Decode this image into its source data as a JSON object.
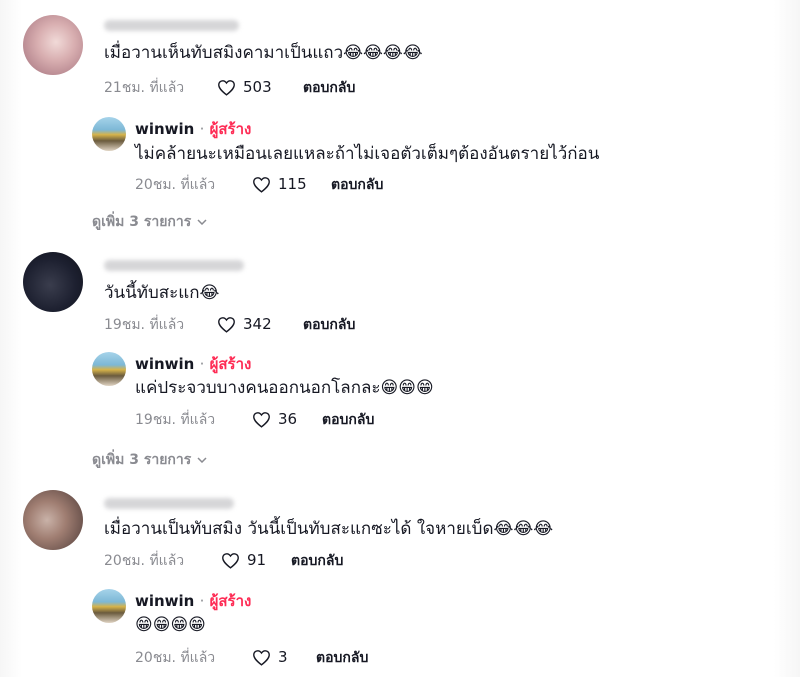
{
  "threads": [
    {
      "comment": {
        "text": "เมื่อวานเห็นทับสมิงคามาเป็นแถว",
        "emojis": "😂😂😂😂",
        "time": "21ชม. ที่แล้ว",
        "likes": "503",
        "reply_label": "ตอบกลับ"
      },
      "reply": {
        "user": "winwin",
        "separator": "·",
        "role": "ผู้สร้าง",
        "text": "ไม่คล้ายนะเหมือนเลยแหละถ้าไม่เจอตัวเต็มๆต้องอันตรายไว้ก่อน",
        "emojis": "",
        "time": "20ชม. ที่แล้ว",
        "likes": "115",
        "reply_label": "ตอบกลับ"
      },
      "more": "ดูเพิ่ม 3 รายการ"
    },
    {
      "comment": {
        "text": "วันนี้ทับสะแก",
        "emojis": "😂",
        "time": "19ชม. ที่แล้ว",
        "likes": "342",
        "reply_label": "ตอบกลับ"
      },
      "reply": {
        "user": "winwin",
        "separator": "·",
        "role": "ผู้สร้าง",
        "text": "แค่ประจวบบางคนออกนอกโลกละ",
        "emojis": "😁😁😁",
        "time": "19ชม. ที่แล้ว",
        "likes": "36",
        "reply_label": "ตอบกลับ"
      },
      "more": "ดูเพิ่ม 3 รายการ"
    },
    {
      "comment": {
        "text": "เมื่อวานเป็นทับสมิง วันนี้เป็นทับสะแกซะได้ ใจหายเบ็ด",
        "emojis": "😂😂😂",
        "time": "20ชม. ที่แล้ว",
        "likes": "91",
        "reply_label": "ตอบกลับ"
      },
      "reply": {
        "user": "winwin",
        "separator": "·",
        "role": "ผู้สร้าง",
        "text": "",
        "emojis": "😁😁😁😁",
        "time": "20ชม. ที่แล้ว",
        "likes": "3",
        "reply_label": "ตอบกลับ"
      }
    }
  ],
  "colors": {
    "creator": "#fe2c55",
    "meta": "#8a8b91",
    "text": "#161823"
  },
  "icons": {
    "like": "heart-outline-icon",
    "expand": "chevron-down-icon"
  }
}
